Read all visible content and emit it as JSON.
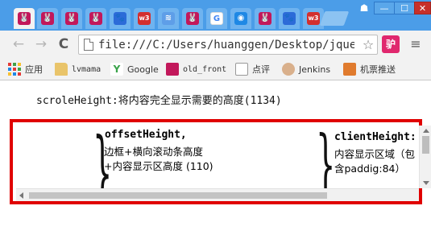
{
  "tabs": [
    {
      "icon": "rabbit-icon",
      "glyph": "🐰"
    },
    {
      "icon": "rabbit-icon",
      "glyph": "🐰"
    },
    {
      "icon": "rabbit-icon",
      "glyph": "🐰"
    },
    {
      "icon": "rabbit-icon",
      "glyph": "🐰"
    },
    {
      "icon": "paw-icon",
      "glyph": "🐾"
    },
    {
      "icon": "w3-icon",
      "glyph": "w3"
    },
    {
      "icon": "chromium-icon",
      "glyph": "≋"
    },
    {
      "icon": "rabbit-icon",
      "glyph": "🐰"
    },
    {
      "icon": "google-icon",
      "glyph": "G"
    },
    {
      "icon": "cloud-icon",
      "glyph": "◉"
    },
    {
      "icon": "rabbit-icon",
      "glyph": "🐰"
    },
    {
      "icon": "paw-icon",
      "glyph": "🐾"
    },
    {
      "icon": "w3-icon",
      "glyph": "w3"
    }
  ],
  "window": {
    "minimize": "—",
    "maximize": "☐",
    "close": "✕",
    "user": "☗"
  },
  "toolbar": {
    "back": "←",
    "forward": "→",
    "reload": "C",
    "url": "file:///C:/Users/huanggen/Desktop/jquer",
    "star": "☆",
    "extension": "驴",
    "menu": "≡"
  },
  "bookmarks": [
    {
      "label": "应用",
      "icon": "apps-icon"
    },
    {
      "label": "lvmama",
      "icon": "folder-icon"
    },
    {
      "label": "Google",
      "icon": "yandex-icon"
    },
    {
      "label": "old_front",
      "icon": "rabbit-icon"
    },
    {
      "label": "点评",
      "icon": "document-icon"
    },
    {
      "label": "Jenkins",
      "icon": "jenkins-icon"
    },
    {
      "label": "机票推送",
      "icon": "flight-icon"
    }
  ],
  "page": {
    "scroll_height_text": "scroleHeight:将内容完全显示需要的高度(1134)",
    "offset_title": "offsetHeight,",
    "offset_line1": "边框+横向滚动条高度",
    "offset_line2": "+内容显示区高度 (110)",
    "client_title": "clientHeight:",
    "client_line1": "内容显示区域（包",
    "client_line2": "含paddig:84）"
  },
  "colors": {
    "tabstrip": "#4b9de8",
    "highlight_border": "#e00000"
  }
}
